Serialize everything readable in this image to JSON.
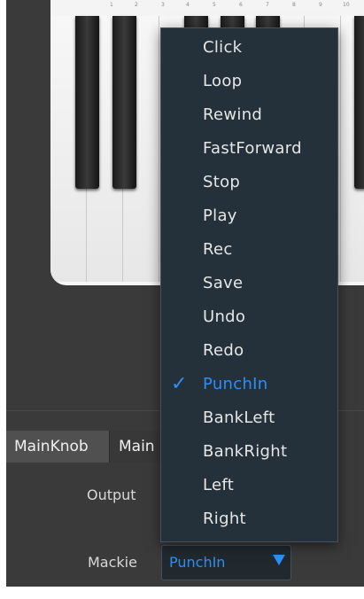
{
  "tabs": [
    {
      "label": "MainKnob"
    },
    {
      "label": "Main"
    }
  ],
  "fields": {
    "output_label": "Output",
    "mackie_label": "Mackie",
    "mackie_value": "PunchIn"
  },
  "ruler_numbers": [
    "1",
    "2",
    "3",
    "4",
    "5",
    "6",
    "7",
    "8",
    "9",
    "10"
  ],
  "menu": {
    "items": [
      {
        "label": "Click"
      },
      {
        "label": "Loop"
      },
      {
        "label": "Rewind"
      },
      {
        "label": "FastForward"
      },
      {
        "label": "Stop"
      },
      {
        "label": "Play"
      },
      {
        "label": "Rec"
      },
      {
        "label": "Save"
      },
      {
        "label": "Undo"
      },
      {
        "label": "Redo"
      },
      {
        "label": "PunchIn",
        "selected": true
      },
      {
        "label": "BankLeft"
      },
      {
        "label": "BankRight"
      },
      {
        "label": "Left"
      },
      {
        "label": "Right"
      }
    ],
    "check_icon": "✓"
  },
  "colors": {
    "accent": "#2f8ff0",
    "menu_bg": "#24313a",
    "panel_bg": "#3a3a3a"
  }
}
